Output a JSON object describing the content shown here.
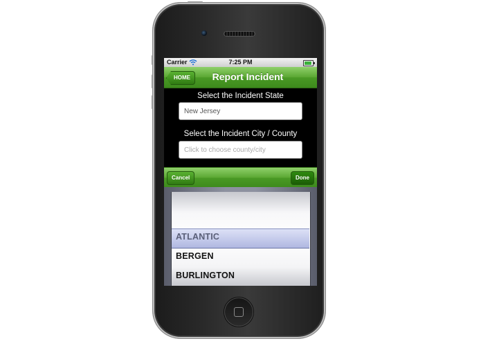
{
  "status_bar": {
    "carrier": "Carrier",
    "time": "7:25 PM"
  },
  "nav_bar": {
    "back_label": "HOME",
    "title": "Report Incident"
  },
  "form": {
    "state_label": "Select the Incident State",
    "state_value": "New Jersey",
    "city_label": "Select the Incident City / County",
    "city_placeholder": "Click to choose county/city"
  },
  "picker_toolbar": {
    "cancel_label": "Cancel",
    "done_label": "Done"
  },
  "picker": {
    "items": [
      "ATLANTIC",
      "BERGEN",
      "BURLINGTON"
    ],
    "selected": "ATLANTIC"
  },
  "colors": {
    "nav_green": "#5aa732",
    "battery_green": "#3bb03b"
  },
  "icons": [
    "wifi-icon",
    "battery-icon",
    "home-button-icon"
  ]
}
